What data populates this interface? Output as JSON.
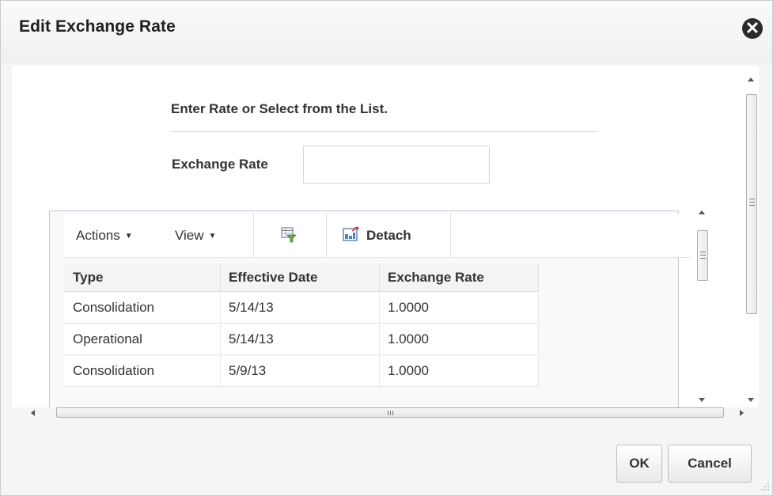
{
  "dialog": {
    "title": "Edit Exchange Rate",
    "close_icon": "close-circle-icon"
  },
  "form": {
    "instruction": "Enter Rate or Select from the List.",
    "exchange_rate_label": "Exchange Rate",
    "exchange_rate_value": ""
  },
  "toolbar": {
    "actions_label": "Actions",
    "view_label": "View",
    "filter_icon": "query-by-example-icon",
    "detach_icon": "detach-icon",
    "detach_label": "Detach"
  },
  "table": {
    "columns": [
      "Type",
      "Effective Date",
      "Exchange Rate"
    ],
    "rows": [
      [
        "Consolidation",
        "5/14/13",
        "1.0000"
      ],
      [
        "Operational",
        "5/14/13",
        "1.0000"
      ],
      [
        "Consolidation",
        "5/9/13",
        "1.0000"
      ]
    ]
  },
  "footer": {
    "ok_label": "OK",
    "cancel_label": "Cancel"
  }
}
